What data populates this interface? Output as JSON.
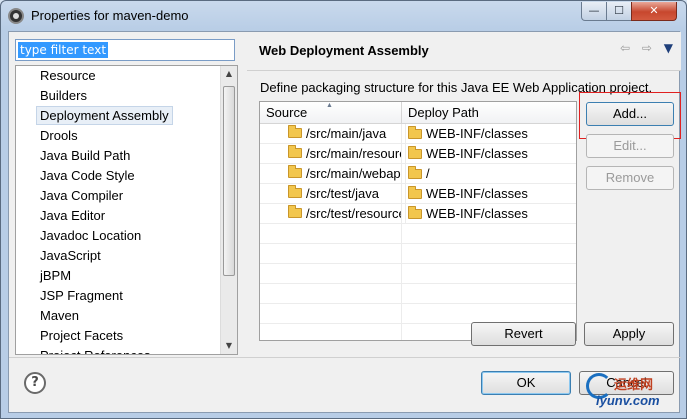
{
  "window": {
    "title": "Properties for maven-demo",
    "minimize": "—",
    "maximize": "☐",
    "close": "✕"
  },
  "filter": {
    "value": "type filter text"
  },
  "nav": {
    "items": [
      "Resource",
      "Builders",
      "Deployment Assembly",
      "Drools",
      "Java Build Path",
      "Java Code Style",
      "Java Compiler",
      "Java Editor",
      "Javadoc Location",
      "JavaScript",
      "jBPM",
      "JSP Fragment",
      "Maven",
      "Project Facets",
      "Project References"
    ],
    "selected": "Deployment Assembly"
  },
  "page": {
    "title": "Web Deployment Assembly",
    "description": "Define packaging structure for this Java EE Web Application project.",
    "icons": {
      "back": "⇦",
      "forward": "⇨",
      "menu": "▼"
    }
  },
  "table": {
    "columns": {
      "source": "Source",
      "deploy_path": "Deploy Path"
    },
    "rows": [
      {
        "source": "/src/main/java",
        "deploy": "WEB-INF/classes"
      },
      {
        "source": "/src/main/resources",
        "deploy": "WEB-INF/classes"
      },
      {
        "source": "/src/main/webapp",
        "deploy": "/"
      },
      {
        "source": "/src/test/java",
        "deploy": "WEB-INF/classes"
      },
      {
        "source": "/src/test/resources",
        "deploy": "WEB-INF/classes"
      }
    ]
  },
  "buttons": {
    "add": "Add...",
    "edit": "Edit...",
    "remove": "Remove",
    "revert": "Revert",
    "apply": "Apply",
    "ok": "OK",
    "cancel": "Cancel",
    "help": "?"
  },
  "watermark": {
    "top": "运维网",
    "bottom": "iyunv.com"
  },
  "colors": {
    "selection": "#3399ff",
    "highlight_box": "#e02020",
    "close_button": "#c7472e"
  }
}
